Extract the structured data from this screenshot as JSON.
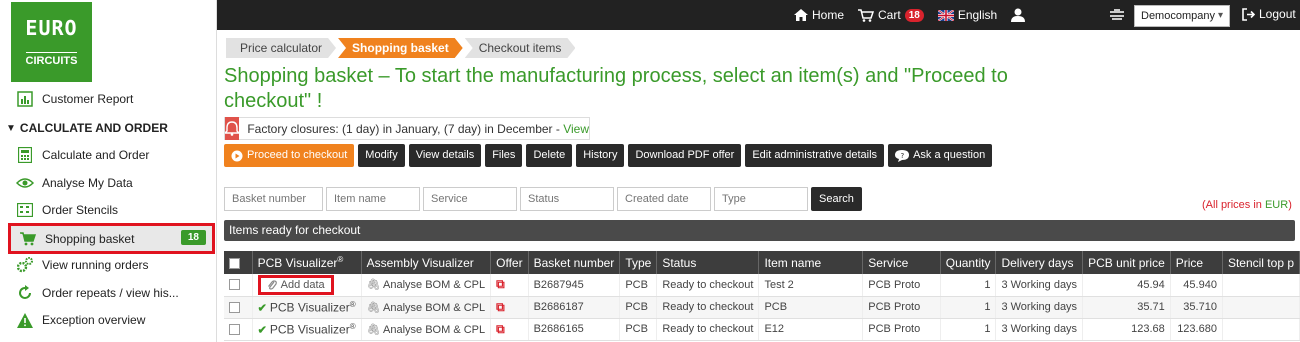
{
  "topnav": {
    "home": "Home",
    "cart": "Cart",
    "cart_count": "18",
    "language": "English",
    "company": "Democompany",
    "logout": "Logout"
  },
  "logo": {
    "line1": "EURO",
    "line2": "",
    "line3": "CIRCUITS"
  },
  "sidebar": {
    "customer_report": "Customer Report",
    "section": "CALCULATE AND ORDER",
    "items": [
      {
        "label": "Calculate and Order",
        "icon": "calculator-icon"
      },
      {
        "label": "Analyse My Data",
        "icon": "eye-icon"
      },
      {
        "label": "Order Stencils",
        "icon": "stencil-icon"
      },
      {
        "label": "Shopping basket",
        "icon": "cart-icon",
        "badge": "18"
      },
      {
        "label": "View running orders",
        "icon": "gears-icon"
      },
      {
        "label": "Order repeats / view his...",
        "icon": "refresh-icon"
      },
      {
        "label": "Exception overview",
        "icon": "warning-icon"
      }
    ]
  },
  "breadcrumb": [
    "Price calculator",
    "Shopping basket",
    "Checkout items"
  ],
  "page_title": "Shopping basket – To start the manufacturing process, select an item(s) and \"Proceed to checkout\" !",
  "notice": {
    "text": "Factory closures: (1 day) in January, (7 day) in December - ",
    "link": "View"
  },
  "actions": {
    "proceed": "Proceed to checkout",
    "modify": "Modify",
    "view_details": "View details",
    "files": "Files",
    "delete": "Delete",
    "history": "History",
    "download_pdf": "Download PDF offer",
    "edit_admin": "Edit administrative details",
    "ask": "Ask a question"
  },
  "filters": {
    "basket_number": "Basket number",
    "item_name": "Item name",
    "service": "Service",
    "status": "Status",
    "created_date": "Created date",
    "type": "Type",
    "search": "Search"
  },
  "prices_note": {
    "prefix": "(All prices in ",
    "currency": "EUR",
    "suffix": ")"
  },
  "section_title": "Items ready for checkout",
  "table": {
    "headers": [
      "PCB Visualizer",
      "Assembly Visualizer",
      "Offer",
      "Basket number",
      "Type",
      "Status",
      "Item name",
      "Service",
      "Quantity",
      "Delivery days",
      "PCB unit price",
      "Price",
      "Stencil top p"
    ],
    "add_data": "Add data",
    "pcb_visualizer": "PCB Visualizer",
    "analyse": "Analyse BOM & CPL",
    "rows": [
      {
        "basket": "B2687945",
        "type": "PCB",
        "status": "Ready to checkout",
        "item": "Test 2",
        "service": "PCB Proto",
        "qty": "1",
        "delivery": "3 Working days",
        "unit": "45.94",
        "price": "45.940"
      },
      {
        "basket": "B2686187",
        "type": "PCB",
        "status": "Ready to checkout",
        "item": "PCB",
        "service": "PCB Proto",
        "qty": "1",
        "delivery": "3 Working days",
        "unit": "35.71",
        "price": "35.710"
      },
      {
        "basket": "B2686165",
        "type": "PCB",
        "status": "Ready to checkout",
        "item": "E12",
        "service": "PCB Proto",
        "qty": "1",
        "delivery": "3 Working days",
        "unit": "123.68",
        "price": "123.680"
      }
    ]
  },
  "colors": {
    "brand_green": "#3a9a2a",
    "accent_orange": "#f0821e",
    "highlight_red": "#e0131f"
  }
}
